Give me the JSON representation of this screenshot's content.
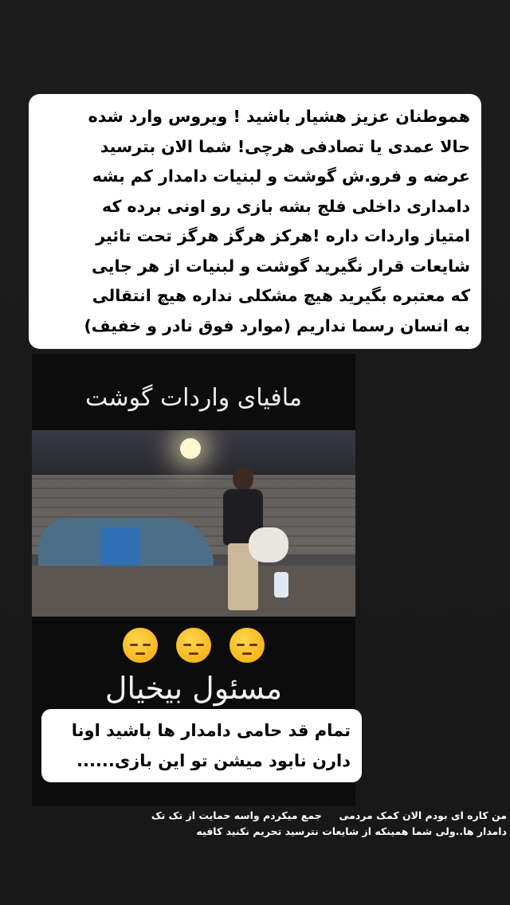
{
  "story": {
    "caption_top": "هموطنان عزیز هشیار باشید ! ویروس وارد شده\nحالا عمدی یا تصادفی هرچی! شما الان بترسید\nعرضه و فرو.ش گوشت و لبنیات  دامدار کم بشه\nدامداری داخلی فلج بشه بازی رو اونی برده که\nامتیاز واردات داره !هرکز هرگز هرگز تحت تائیر\nشایعات قرار نگیرید گوشت و لبنیات از هر جایی\nکه معتبره بگیرید هیچ مشکلی نداره هیچ انتقالی\nبه انسان رسما نداریم (موارد فوق نادر و خفیف)",
    "video_title": "مافیای واردات گوشت",
    "emoji_icons": [
      "pensive-face-icon",
      "pensive-face-icon",
      "pensive-face-icon"
    ],
    "video_subtitle": "مسئول بیخیال",
    "caption_mid": "تمام قد حامی دامدار ها باشید اونا\nدارن نابود میشن تو این بازی......",
    "caption_bottom": "من کاره ای بودم الان کمک مردمی     جمع میکردم واسه حمایت از تک تک\nدامدار ها..ولی شما همینکه از شایعات نترسید تحریم نکنید کافیه"
  }
}
